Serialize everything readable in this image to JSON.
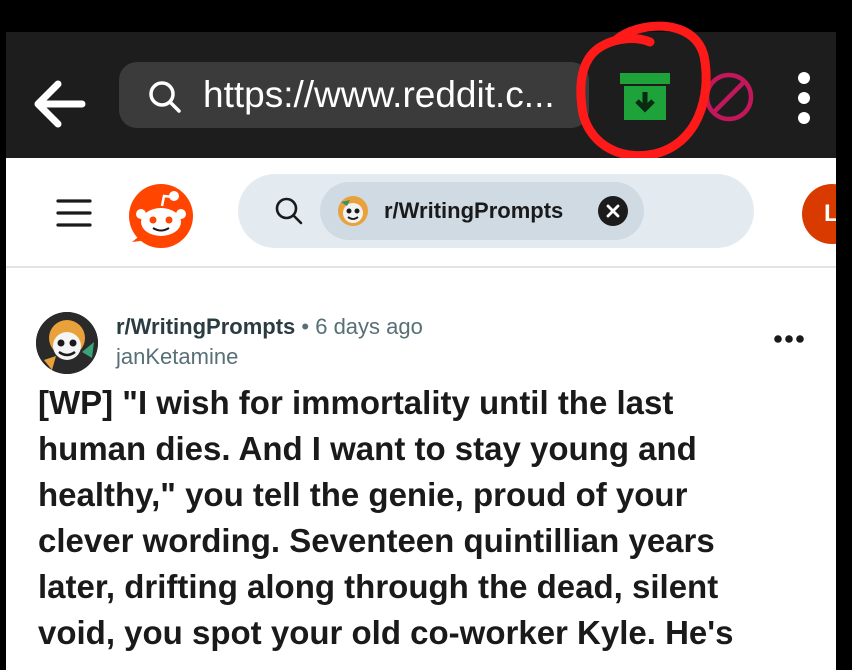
{
  "browser": {
    "url": "https://www.reddit.c...",
    "icons": {
      "back": "back-arrow-icon",
      "search": "search-icon",
      "archive": "archive-download-icon",
      "block": "block-icon",
      "more": "more-vertical-icon"
    },
    "colors": {
      "bar": "#1d1d1d",
      "url_pill": "#3b3b3b",
      "archive_green": "#1ea23a",
      "block_pink": "#c2185b",
      "annotation_red": "#ff1a1a"
    }
  },
  "reddit": {
    "search_chip": {
      "label": "r/WritingPrompts"
    },
    "colors": {
      "brand": "#ff4500",
      "search_bg": "#e4ebf0",
      "chip_bg": "#cfdae3"
    },
    "user_initial": "L"
  },
  "post": {
    "subreddit": "r/WritingPrompts",
    "separator": "•",
    "age": "6 days ago",
    "author": "janKetamine",
    "title_lines": [
      "[WP] \"I wish for immortality until the last",
      "human dies. And I want to stay young and",
      "healthy,\" you tell the genie, proud of your",
      "clever wording. Seventeen quintillian years",
      "later, drifting along through the dead, silent",
      "void, you spot your old co-worker Kyle. He's"
    ]
  }
}
